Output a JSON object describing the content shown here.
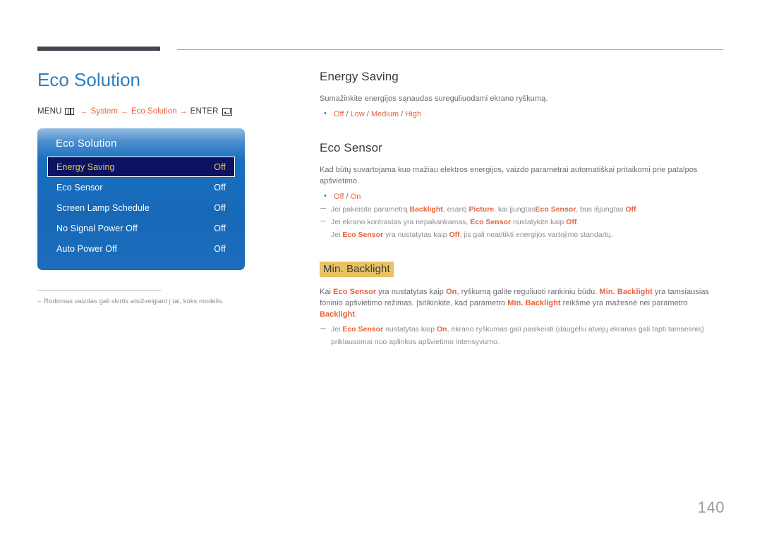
{
  "document": {
    "page_number": "140"
  },
  "left": {
    "title": "Eco Solution",
    "breadcrumb": {
      "menu_label": "MENU",
      "menu_icon": "menu-grid-icon",
      "arrow": "→",
      "item1": "System",
      "item2": "Eco Solution",
      "enter_label": "ENTER",
      "enter_icon": "enter-return-icon"
    },
    "osd": {
      "title": "Eco Solution",
      "rows": [
        {
          "label": "Energy Saving",
          "value": "Off",
          "selected": true
        },
        {
          "label": "Eco Sensor",
          "value": "Off",
          "selected": false
        },
        {
          "label": "Screen Lamp Schedule",
          "value": "Off",
          "selected": false
        },
        {
          "label": "No Signal Power Off",
          "value": "Off",
          "selected": false
        },
        {
          "label": "Auto Power Off",
          "value": "Off",
          "selected": false
        }
      ]
    },
    "footnote": {
      "dash": "–",
      "text": "Rodomas vaizdas gali skirtis atsižvelgiant į tai, koks modelis."
    }
  },
  "right": {
    "energy_saving": {
      "heading": "Energy Saving",
      "paragraph": "Sumažinkite energijos sąnaudas sureguliuodami ekrano ryškumą.",
      "options": [
        "Off",
        "Low",
        "Medium",
        "High"
      ],
      "options_separator": " / "
    },
    "eco_sensor": {
      "heading": "Eco Sensor",
      "paragraph": "Kad būtų suvartojama kuo mažiau elektros energijos, vaizdo parametrai automatiškai pritaikomi prie patalpos apšvietimo.",
      "options": [
        "Off",
        "On"
      ],
      "options_separator": " / ",
      "note1_a": "Jei pakeisite parametrą ",
      "note1_b": "Backlight",
      "note1_c": ", esantį ",
      "note1_d": "Picture",
      "note1_e": ", kai įjungtas",
      "note1_f": "Eco Sensor",
      "note1_g": ", bus išjungtas ",
      "note1_h": "Off",
      "note1_i": ".",
      "note2_a": "Jei ekrano kontrastas yra nepakankamas, ",
      "note2_b": "Eco Sensor",
      "note2_c": " nustatykite kaip ",
      "note2_d": "Off",
      "note2_e": ".",
      "note3_a": "Jei ",
      "note3_b": "Eco Sensor",
      "note3_c": " yra nustatytas kaip ",
      "note3_d": "Off",
      "note3_e": ", jis gali neatitikti energijos vartojimo standartų."
    },
    "min_backlight": {
      "heading": "Min. Backlight",
      "para_a": "Kai ",
      "para_b": "Eco Sensor",
      "para_c": " yra nustatytas kaip ",
      "para_d": "On",
      "para_e": ", ryškumą galite reguliuoti rankiniu būdu. ",
      "para_f": "Min. Backlight",
      "para_g": " yra tamsiausias foninio apšvietimo režimas. Įsitikinkite, kad parametro ",
      "para_h": "Min. Backlight",
      "para_i": " reikšmė yra mažesnė nei parametro ",
      "para_j": "Backlight",
      "para_k": ".",
      "note_a": "Jei ",
      "note_b": "Eco Sensor",
      "note_c": " nustatytas kaip ",
      "note_d": "On",
      "note_e": ", ekrano ryškumas gali pasikeisti (daugeliu atvejų ekranas gali tapti tamsesnis)",
      "note_f": "priklausomai nuo aplinkos apšvietimo intensyvumo."
    }
  },
  "colors": {
    "heading_blue": "#2c7fc0",
    "accent_orange": "#e8603c",
    "highlight_gold": "#e8c264",
    "osd_blue": "#1769b8",
    "osd_selected": "#0c1461",
    "osd_selected_text": "#f0c14a"
  }
}
